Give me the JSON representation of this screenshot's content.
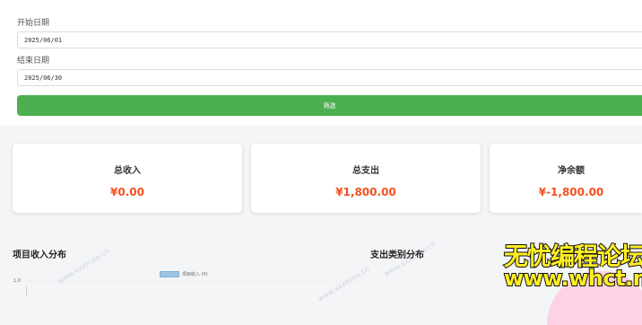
{
  "filter": {
    "start_label": "开始日期",
    "start_value": "2025/06/01",
    "end_label": "结束日期",
    "end_value": "2025/06/30",
    "button_label": "筛选",
    "button_color": "#4caf50"
  },
  "summary": {
    "income": {
      "title": "总收入",
      "value": "¥0.00"
    },
    "expense": {
      "title": "总支出",
      "value": "¥1,800.00"
    },
    "balance": {
      "title": "净余额",
      "value": "¥-1,800.00"
    },
    "value_color": "#f4511e"
  },
  "sections": {
    "project_income": "项目收入分布",
    "expense_category": "支出类别分布"
  },
  "chart_data": {
    "type": "bar",
    "series": [
      {
        "name": "项目收入 (¥)",
        "values": []
      }
    ],
    "categories": [],
    "ytick_labels": [
      "1.0"
    ],
    "legend": "top-center"
  },
  "watermarks": [
    "www.xxxmaw.cn",
    "www.xxxmaw.cn",
    "www.xxxmaw.cn"
  ],
  "overlay": {
    "line1": "无忧编程论坛",
    "line2": "www.whct.net"
  }
}
